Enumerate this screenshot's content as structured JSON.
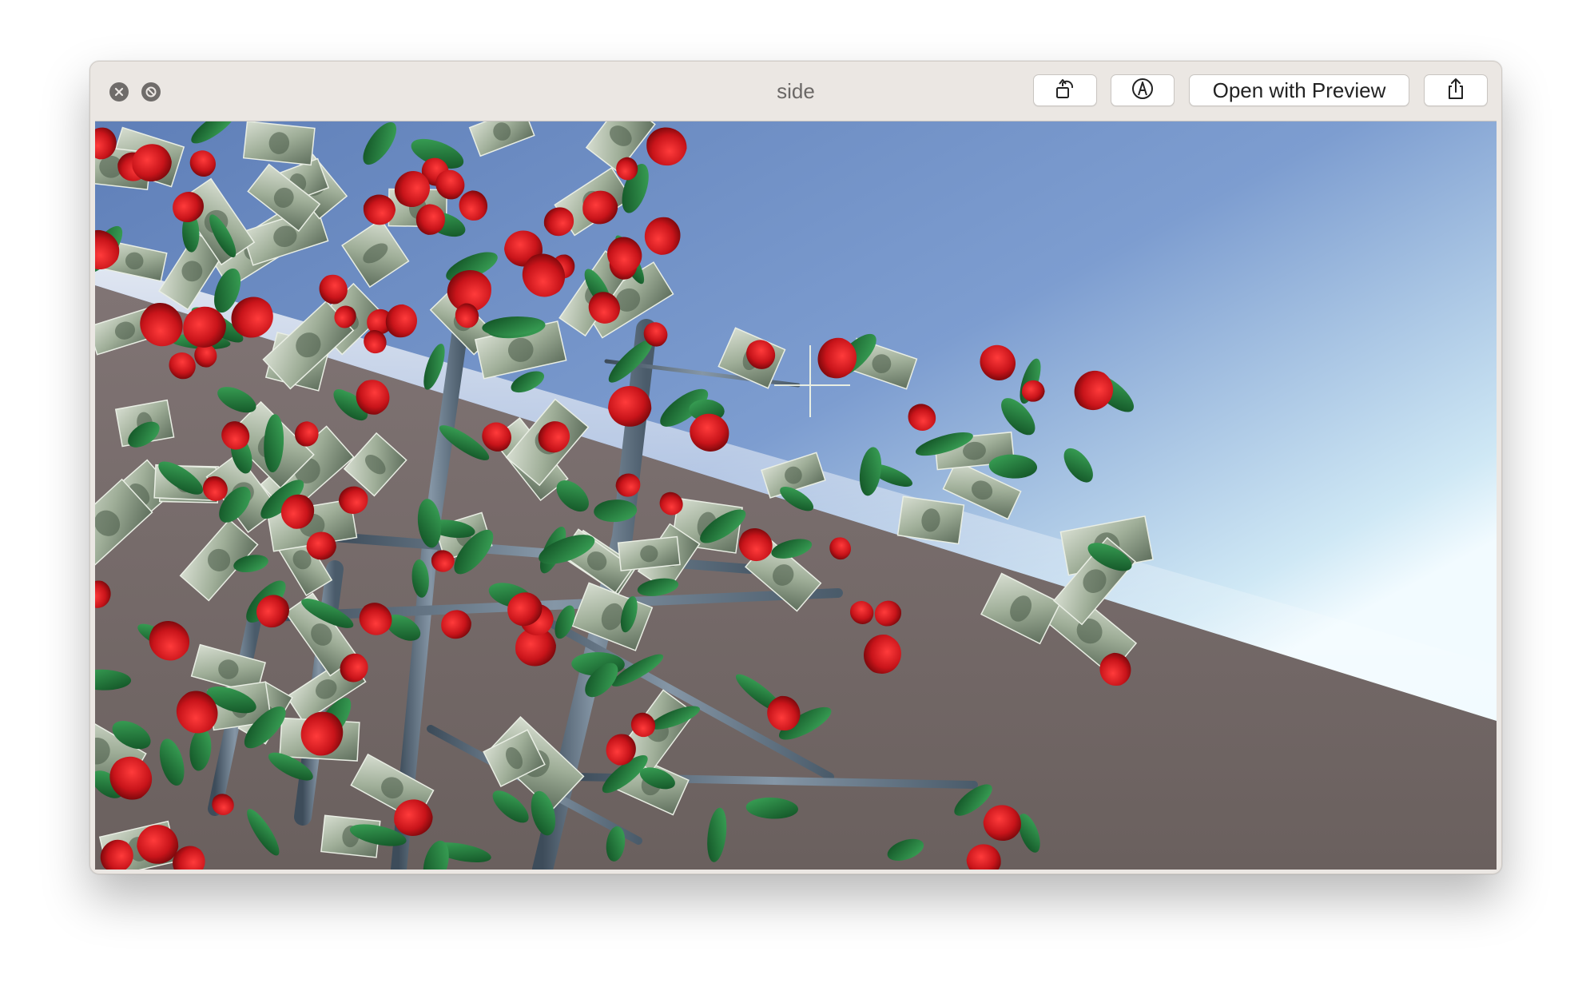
{
  "window": {
    "title": "side"
  },
  "toolbar": {
    "close_icon": "close-icon",
    "fullscreen_icon": "fullscreen-icon",
    "rotate_icon": "rotate-left-icon",
    "markup_icon": "markup-pen-icon",
    "open_with_label": "Open with Preview",
    "share_icon": "share-icon"
  },
  "preview": {
    "description_icon": "3d-render-image",
    "colors": {
      "sky_top": "#6e8cc0",
      "sky_horizon": "#e8f6fa",
      "ground": "#6e6462",
      "rose_red": "#c8141a",
      "leaf_green": "#1f7a3a",
      "bill_green": "#a8b5a0",
      "branch_gray": "#5d6f80"
    }
  }
}
